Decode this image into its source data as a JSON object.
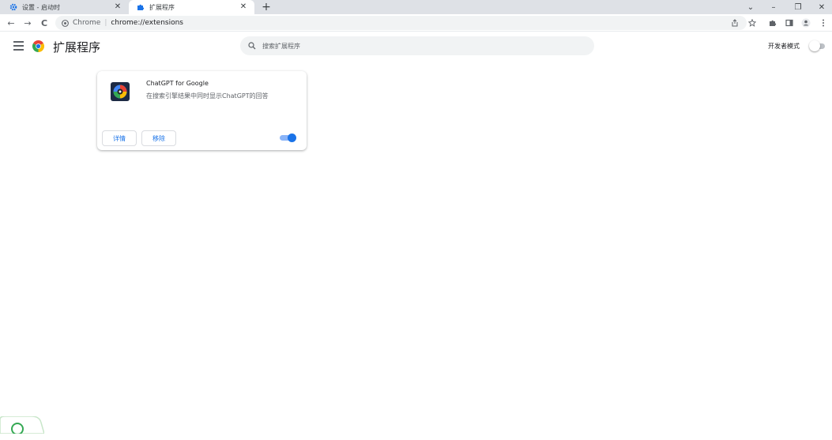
{
  "tabs": [
    {
      "title": "设置 - 启动时",
      "icon": "gear-icon",
      "active": false
    },
    {
      "title": "扩展程序",
      "icon": "puzzle-icon",
      "active": true
    }
  ],
  "tab_close_glyph": "✕",
  "new_tab_glyph": "+",
  "window_controls": {
    "dropdown": "⌄",
    "minimize": "–",
    "restore": "❐",
    "close": "✕"
  },
  "toolbar": {
    "back": "←",
    "forward": "→",
    "reload": "C",
    "site_label": "Chrome",
    "separator": "|",
    "url": "chrome://extensions"
  },
  "header": {
    "title": "扩展程序",
    "search_placeholder": "搜索扩展程序",
    "dev_mode_label": "开发者模式",
    "dev_mode_on": false
  },
  "extensions": [
    {
      "name": "ChatGPT for Google",
      "description": "在搜索引擎结果中同时显示ChatGPT的回答",
      "details_label": "详情",
      "remove_label": "移除",
      "enabled": true
    }
  ],
  "colors": {
    "accent": "#1a73e8",
    "tabstrip": "#dee1e6",
    "omnibox": "#f1f3f4"
  }
}
